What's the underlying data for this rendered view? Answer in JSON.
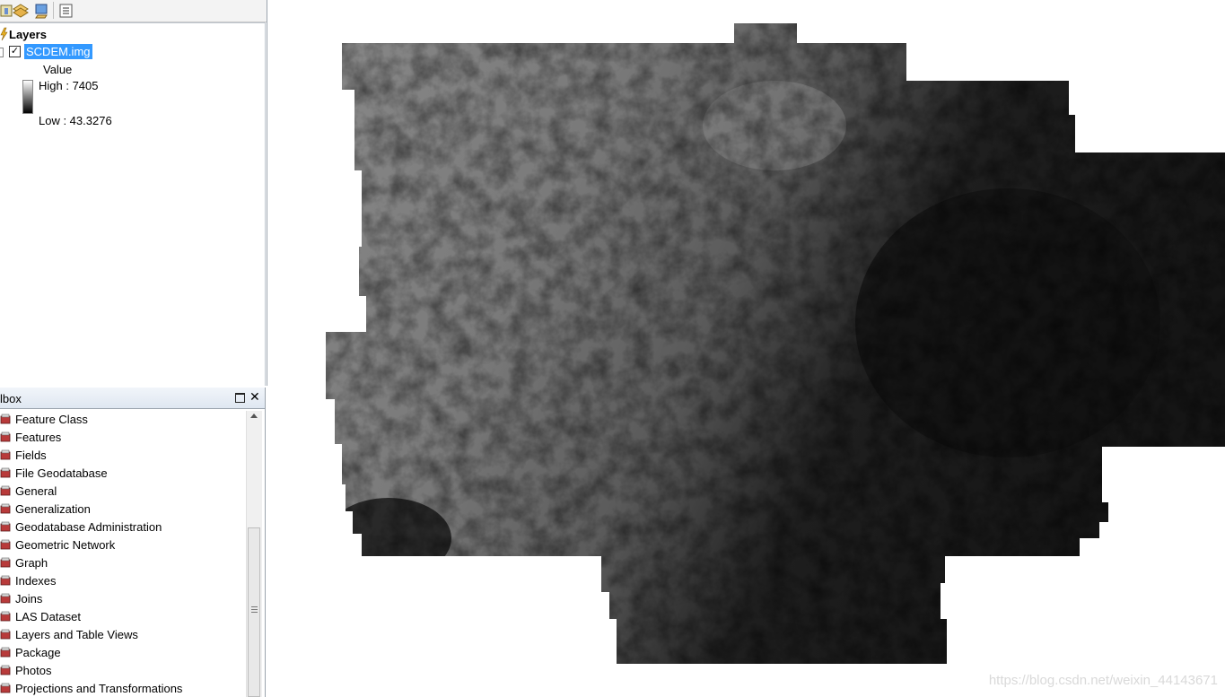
{
  "toc": {
    "toolbar": {
      "buttons": [
        "list-by-drawing-order-icon",
        "list-by-source-icon",
        "list-by-visibility-icon",
        "options-icon"
      ]
    },
    "layers_title": "Layers",
    "layer": {
      "name": "SCDEM.img",
      "checked": true,
      "legend_title": "Value",
      "high_label": "High : 7405",
      "low_label": "Low : 43.3276",
      "ramp_colors": [
        "#ffffff",
        "#000000"
      ]
    }
  },
  "toolbox": {
    "title": "lbox",
    "items": [
      "Feature Class",
      "Features",
      "Fields",
      "File Geodatabase",
      "General",
      "Generalization",
      "Geodatabase Administration",
      "Geometric Network",
      "Graph",
      "Indexes",
      "Joins",
      "LAS Dataset",
      "Layers and Table Views",
      "Package",
      "Photos",
      "Projections and Transformations"
    ]
  },
  "map": {
    "watermark": "https://blog.csdn.net/weixin_44143671"
  },
  "colors": {
    "selection": "#3399ff",
    "panel_header": "#dfe7f1"
  }
}
